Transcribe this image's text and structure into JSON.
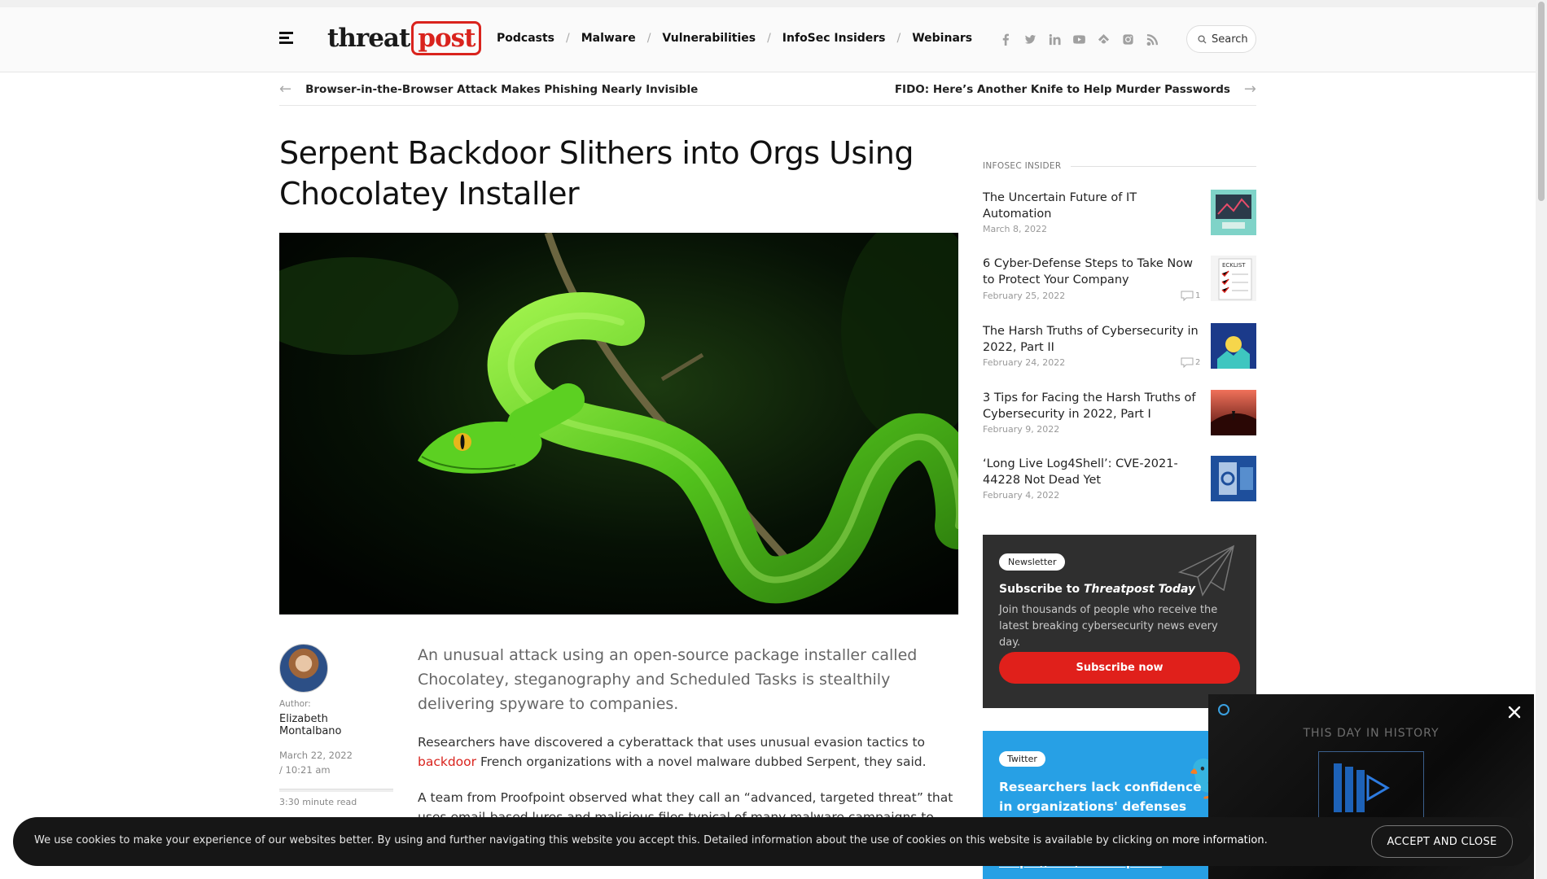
{
  "header": {
    "logo_threat": "threat",
    "logo_post": "post",
    "nav": [
      "Podcasts",
      "Malware",
      "Vulnerabilities",
      "InfoSec Insiders",
      "Webinars"
    ],
    "nav_sep": "/",
    "social_icons": [
      "facebook-icon",
      "twitter-icon",
      "linkedin-icon",
      "youtube-icon",
      "feedly-icon",
      "instagram-icon",
      "rss-icon"
    ],
    "search_label": "Search"
  },
  "prevnext": {
    "prev": "Browser-in-the-Browser Attack Makes Phishing Nearly Invisible",
    "next": "FIDO: Here’s Another Knife to Help Murder Passwords"
  },
  "article": {
    "title": "Serpent Backdoor Slithers into Orgs Using Chocolatey Installer",
    "author_label": "Author:",
    "author_name": "Elizabeth Montalbano",
    "date": "March 22, 2022",
    "time": "/ 10:21 am",
    "read_time": "3:30 minute read",
    "lede": "An unusual attack using an open-source package installer called Chocolatey, steganography and Scheduled Tasks is stealthily delivering spyware to companies.",
    "para1_before": "Researchers have discovered a cyberattack that uses unusual evasion tactics to ",
    "para1_link": "backdoor",
    "para1_after": " French organizations with a novel malware dubbed Serpent, they said.",
    "para2": "A team from Proofpoint observed what they call an “advanced, targeted threat” that uses email-based lures and malicious files typical of many malware campaigns to deliver its"
  },
  "sidebar": {
    "title": "INFOSEC INSIDER",
    "items": [
      {
        "title": "The Uncertain Future of IT Automation",
        "date": "March 8, 2022",
        "comments": ""
      },
      {
        "title": "6 Cyber-Defense Steps to Take Now to Protect Your Company",
        "date": "February 25, 2022",
        "comments": "1"
      },
      {
        "title": "The Harsh Truths of Cybersecurity in 2022, Part II",
        "date": "February 24, 2022",
        "comments": "2"
      },
      {
        "title": "3 Tips for Facing the Harsh Truths of Cybersecurity in 2022, Part I",
        "date": "February 9, 2022",
        "comments": ""
      },
      {
        "title": "‘Long Live Log4Shell’: CVE-2021-44228 Not Dead Yet",
        "date": "February 4, 2022",
        "comments": ""
      }
    ]
  },
  "newsletter": {
    "pill": "Newsletter",
    "head_prefix": "Subscribe to ",
    "head_name": "Threatpost Today",
    "body": "Join thousands of people who receive the latest breaking cybersecurity news every day.",
    "button": "Subscribe now"
  },
  "twitter": {
    "pill": "Twitter",
    "text": "Researchers lack confidence in organizations' defenses against",
    "link": "https://t.co/GotPoqhern"
  },
  "video": {
    "title": "THIS DAY IN HISTORY"
  },
  "cookie": {
    "text": "We use cookies to make your experience of our websites better. By using and further navigating this website you accept this. Detailed information about the use of cookies on this website is available by clicking on ",
    "link": "more information",
    "after": ".",
    "button": "ACCEPT AND CLOSE"
  },
  "colors": {
    "brand_red": "#d9231d",
    "twitter_blue": "#27a0e5",
    "newsletter_bg": "#2f2f2f"
  }
}
